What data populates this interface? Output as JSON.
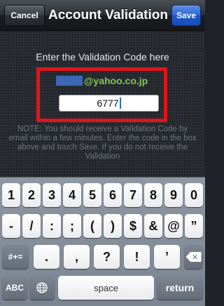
{
  "navbar": {
    "cancel_label": "Cancel",
    "title": "Account Validation",
    "save_label": "Save"
  },
  "content": {
    "instruction": "Enter the Validation Code here",
    "email_domain": "@yahoo.co.jp",
    "code_value": "6777",
    "note": "NOTE: You should receive a Validation Code by email within a few minutes. Enter the code in the box above and touch Save. If you do not receive the Validation"
  },
  "keyboard": {
    "row1": [
      "1",
      "2",
      "3",
      "4",
      "5",
      "6",
      "7",
      "8",
      "9",
      "0"
    ],
    "row2": [
      "-",
      "/",
      ":",
      ";",
      "(",
      ")",
      "$",
      "&",
      "@",
      "”"
    ],
    "row3_toggle": "#+=",
    "row3": [
      ".",
      ",",
      "?",
      "!",
      "’"
    ],
    "abc_label": "ABC",
    "space_label": "space",
    "return_label": "return"
  },
  "colors": {
    "highlight_frame": "#e0141b",
    "email_domain": "#7ec84f",
    "save_button": "#2e66d4"
  },
  "icons": {
    "globe": "globe-icon",
    "backspace": "backspace-icon"
  }
}
